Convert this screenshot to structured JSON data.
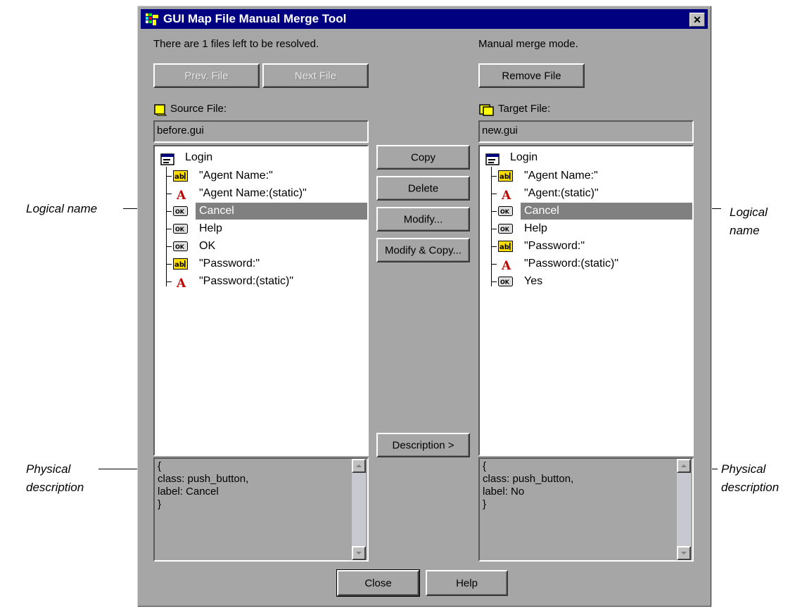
{
  "window": {
    "title": "GUI Map File Manual Merge Tool",
    "close_glyph": "✕"
  },
  "status": {
    "left": "There are 1 files left to be resolved.",
    "right": "Manual merge mode."
  },
  "buttons": {
    "prev": "Prev. File",
    "next": "Next File",
    "remove": "Remove File",
    "copy": "Copy",
    "delete": "Delete",
    "modify": "Modify...",
    "modify_copy": "Modify & Copy...",
    "description": "Description >",
    "close": "Close",
    "help": "Help"
  },
  "source": {
    "label": "Source File:",
    "filename": "before.gui",
    "root": "Login",
    "items": [
      {
        "icon": "edit-icon",
        "label": "\"Agent Name:\""
      },
      {
        "icon": "static-text-icon",
        "label": "\"Agent Name:(static)\""
      },
      {
        "icon": "push-button-icon",
        "label": "Cancel",
        "selected": true
      },
      {
        "icon": "push-button-icon",
        "label": "Help"
      },
      {
        "icon": "push-button-icon",
        "label": "OK"
      },
      {
        "icon": "edit-icon",
        "label": "\"Password:\""
      },
      {
        "icon": "static-text-icon",
        "label": "\"Password:(static)\""
      }
    ],
    "description": [
      "{",
      " class: push_button,",
      " label: Cancel",
      "}"
    ]
  },
  "target": {
    "label": "Target File:",
    "filename": "new.gui",
    "root": "Login",
    "items": [
      {
        "icon": "edit-icon",
        "label": "\"Agent Name:\""
      },
      {
        "icon": "static-text-icon",
        "label": "\"Agent:(static)\""
      },
      {
        "icon": "push-button-icon",
        "label": "Cancel",
        "selected": true
      },
      {
        "icon": "push-button-icon",
        "label": "Help"
      },
      {
        "icon": "edit-icon",
        "label": "\"Password:\""
      },
      {
        "icon": "static-text-icon",
        "label": "\"Password:(static)\""
      },
      {
        "icon": "push-button-icon",
        "label": "Yes"
      }
    ],
    "description": [
      "{",
      " class: push_button,",
      " label: No",
      "}"
    ]
  },
  "callouts": {
    "logical_left": "Logical name",
    "logical_right_1": "Logical",
    "logical_right_2": "name",
    "physical_left_1": "Physical",
    "physical_left_2": "description",
    "physical_right_1": "Physical",
    "physical_right_2": "description"
  },
  "colors": {
    "titlebar": "#000080",
    "dialog": "#a6a6a6",
    "selection": "#808080"
  }
}
